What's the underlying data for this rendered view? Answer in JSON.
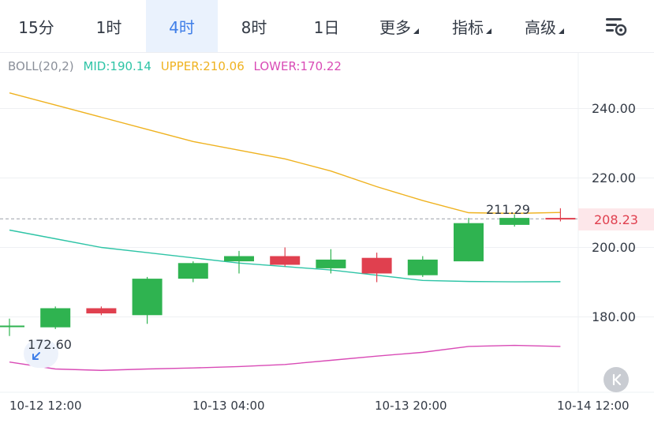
{
  "tabs": [
    {
      "label": "15分",
      "active": false,
      "has_caret": false
    },
    {
      "label": "1时",
      "active": false,
      "has_caret": false
    },
    {
      "label": "4时",
      "active": true,
      "has_caret": false
    },
    {
      "label": "8时",
      "active": false,
      "has_caret": false
    },
    {
      "label": "1日",
      "active": false,
      "has_caret": false
    },
    {
      "label": "更多",
      "active": false,
      "has_caret": true
    },
    {
      "label": "指标",
      "active": false,
      "has_caret": true
    },
    {
      "label": "高级",
      "active": false,
      "has_caret": true
    }
  ],
  "settings_icon": "chart-settings-icon",
  "indicator": {
    "name": "BOLL(20,2)",
    "mid_label": "MID:190.14",
    "upper_label": "UPPER:210.06",
    "lower_label": "LOWER:170.22",
    "colors": {
      "name": "#8a8f99",
      "mid": "#2ec4a6",
      "upper": "#efb21f",
      "lower": "#d94bb6"
    }
  },
  "current_price": "208.23",
  "colors": {
    "up": "#2fb350",
    "down": "#e0404f",
    "mid": "#2ec4a6",
    "upper": "#efb21f",
    "lower": "#d94bb6",
    "accent": "#3f7ee8"
  },
  "chart_data": {
    "type": "candlestick",
    "y_ticks": [
      "240.00",
      "220.00",
      "200.00",
      "180.00"
    ],
    "y_tick_values": [
      240,
      220,
      200,
      180
    ],
    "ylim": [
      164,
      250
    ],
    "x_tick_labels": [
      "10-12 12:00",
      "10-13 04:00",
      "10-13 20:00",
      "10-14 12:00"
    ],
    "candles": [
      {
        "open": 177.5,
        "close": 177.5,
        "high": 179.5,
        "low": 174.5
      },
      {
        "open": 177,
        "close": 182.5,
        "high": 183,
        "low": 176.5
      },
      {
        "open": 182.5,
        "close": 181,
        "high": 183,
        "low": 180.5
      },
      {
        "open": 180.5,
        "close": 191,
        "high": 191.5,
        "low": 178
      },
      {
        "open": 191,
        "close": 195.5,
        "high": 196,
        "low": 190
      },
      {
        "open": 196,
        "close": 197.5,
        "high": 199,
        "low": 192.5
      },
      {
        "open": 197.5,
        "close": 195,
        "high": 200,
        "low": 194.5
      },
      {
        "open": 194,
        "close": 196.5,
        "high": 199.5,
        "low": 192.5
      },
      {
        "open": 197,
        "close": 192.5,
        "high": 198.5,
        "low": 190
      },
      {
        "open": 192,
        "close": 196.5,
        "high": 197.5,
        "low": 191.5
      },
      {
        "open": 196,
        "close": 207,
        "high": 208.5,
        "low": 196
      },
      {
        "open": 206.5,
        "close": 208.5,
        "high": 209.5,
        "low": 206
      },
      {
        "open": 208.5,
        "close": 208.23,
        "high": 211.29,
        "low": 207.5
      }
    ],
    "boll_upper": [
      244.5,
      241,
      237.5,
      234,
      230.5,
      228,
      225.5,
      222,
      217.5,
      213.5,
      210,
      209.8,
      210.06
    ],
    "boll_mid": [
      205,
      202.5,
      200,
      198.5,
      197,
      195.5,
      194.5,
      193.5,
      192,
      190.5,
      190.2,
      190.1,
      190.14
    ],
    "boll_lower": [
      167,
      165,
      164.6,
      165,
      165.3,
      165.7,
      166.3,
      167.5,
      168.7,
      169.8,
      171.5,
      171.8,
      171.5
    ],
    "max_label": "211.29",
    "min_label": "172.60",
    "reference_line": 208.23
  }
}
